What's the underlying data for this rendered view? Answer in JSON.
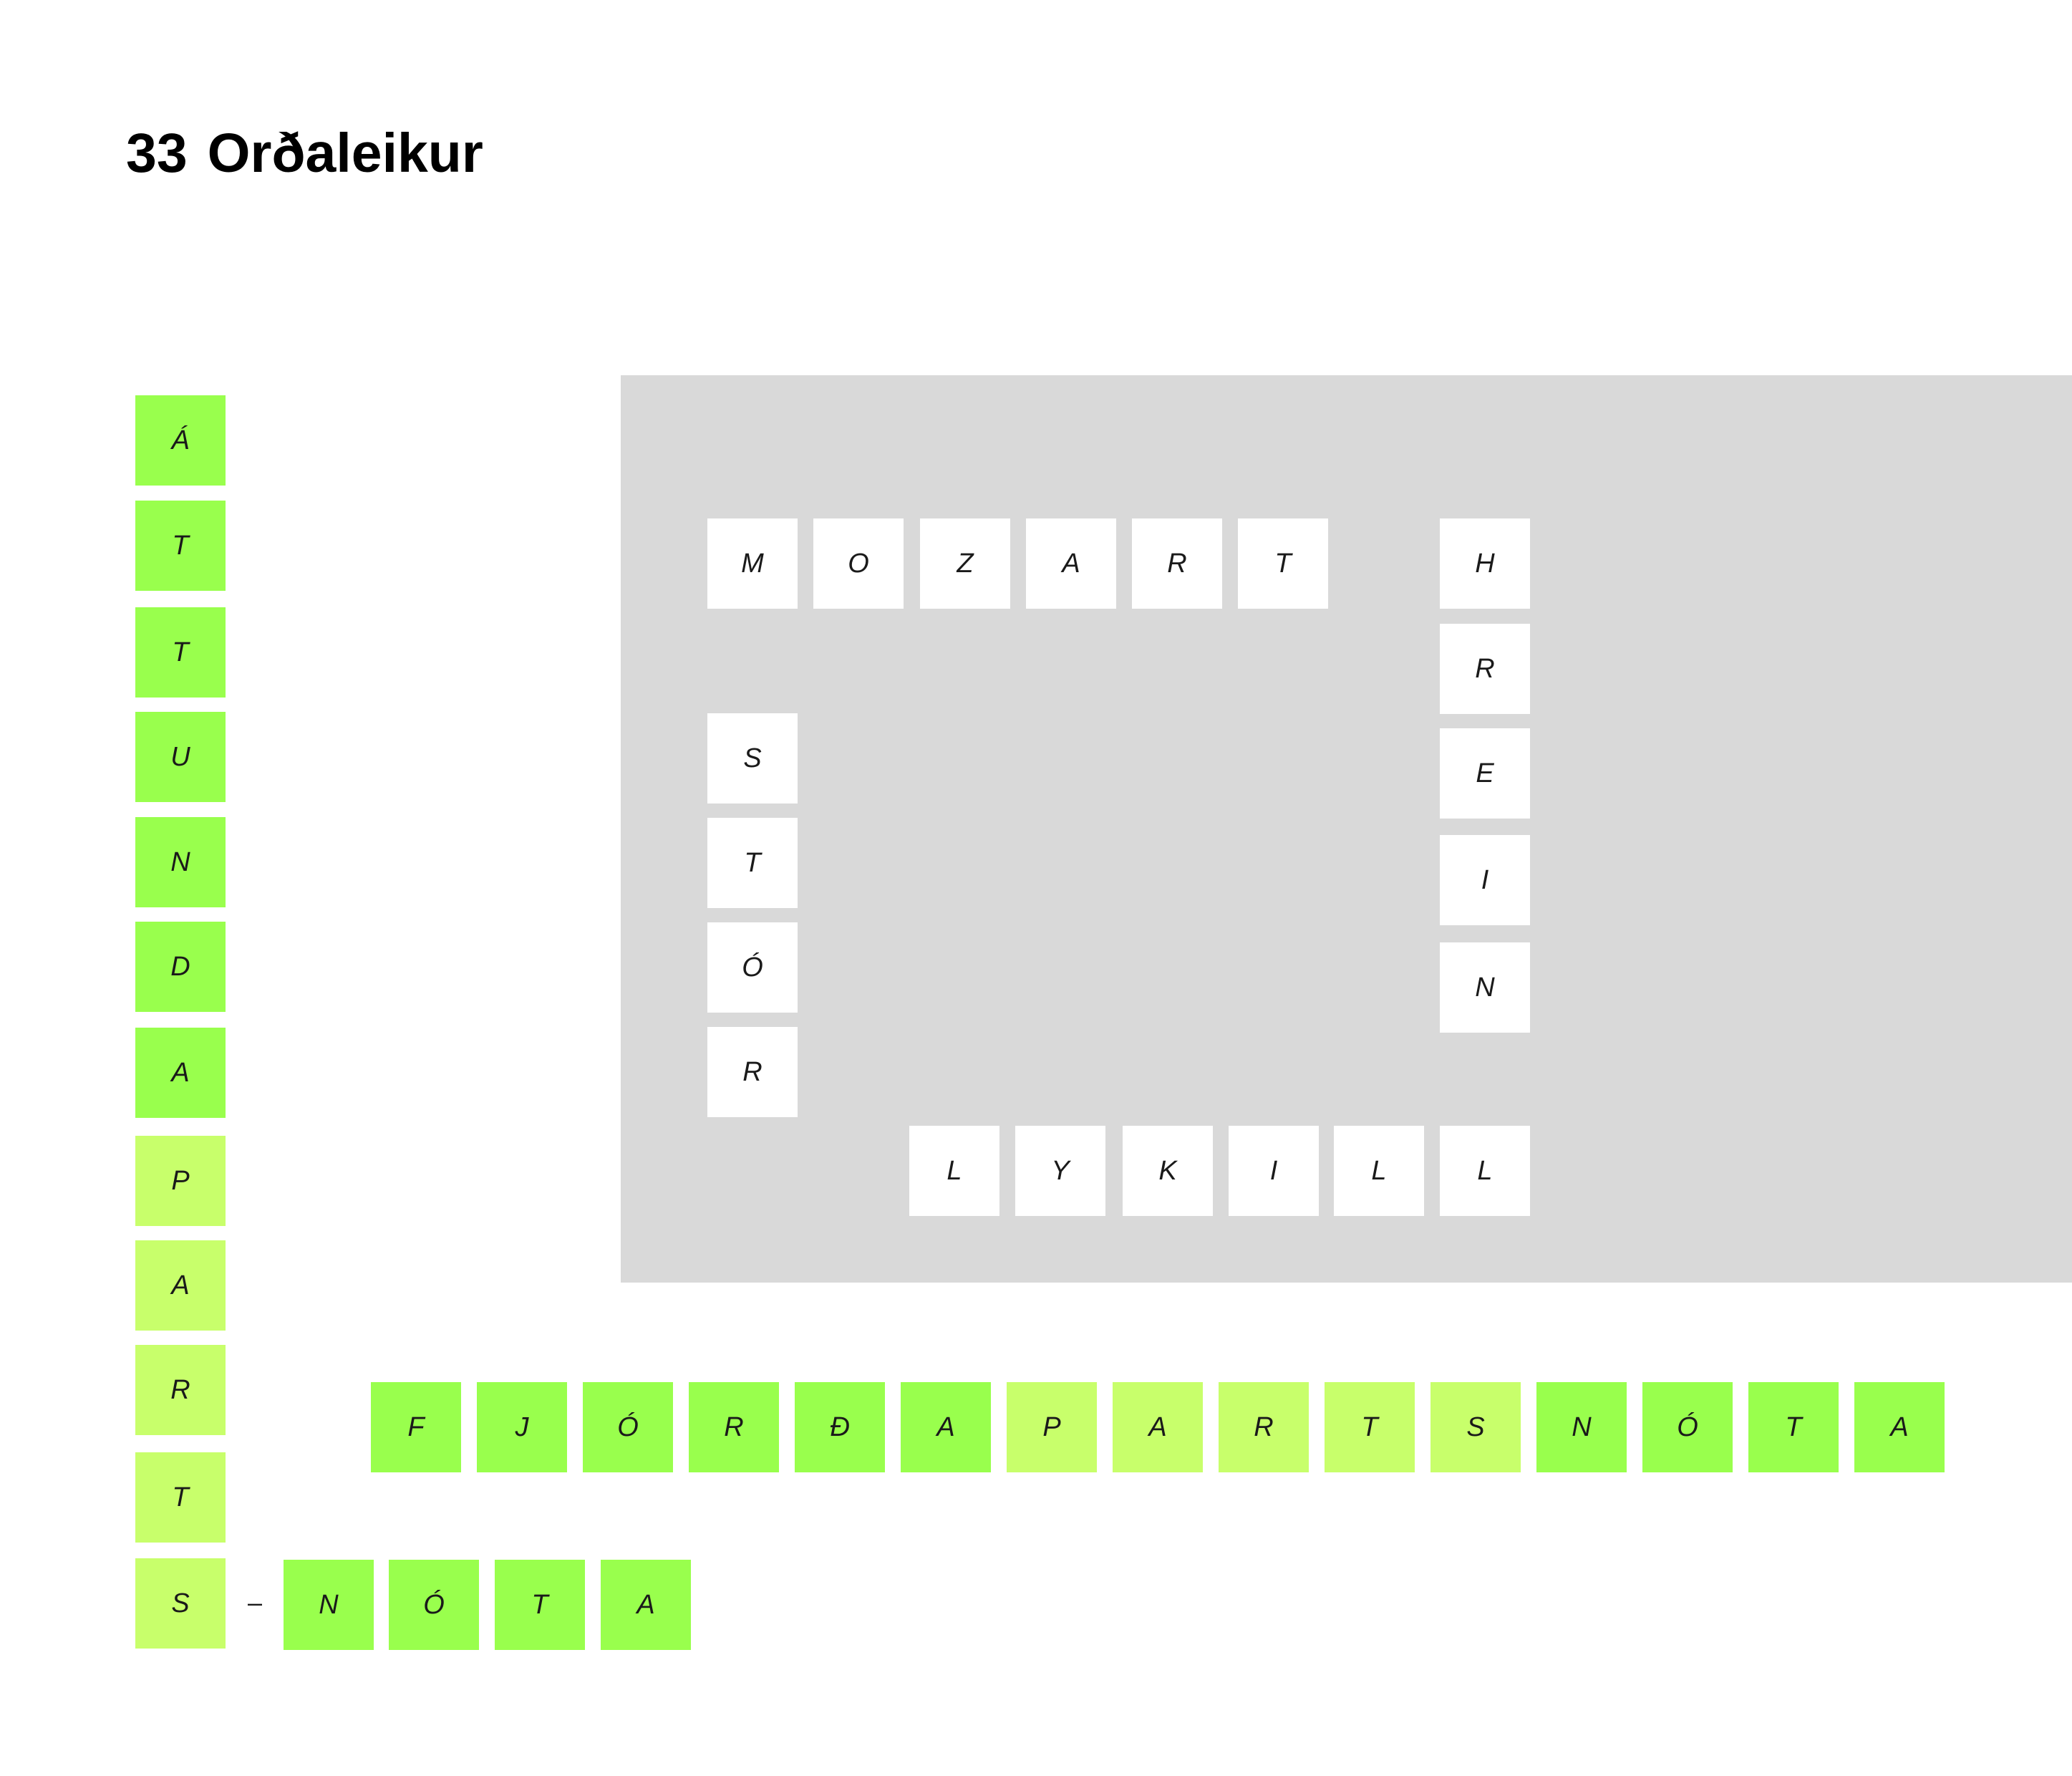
{
  "title": {
    "number": "33",
    "text": "Orðaleikur"
  },
  "colors": {
    "board": "#d9d9d9",
    "white_tile": "#ffffff",
    "green_tile": "#99ff4d",
    "light_green_tile": "#c8ff6b"
  },
  "words": {
    "mozart": [
      "M",
      "O",
      "Z",
      "A",
      "R",
      "T"
    ],
    "hrein": [
      "H",
      "R",
      "E",
      "I",
      "N"
    ],
    "stor": [
      "S",
      "T",
      "Ó",
      "R"
    ],
    "lykill": [
      "L",
      "Y",
      "K",
      "I",
      "L",
      "L"
    ],
    "attundapart_vertical": [
      "Á",
      "T",
      "T",
      "U",
      "N",
      "D",
      "A",
      "P",
      "A",
      "R",
      "T",
      "S"
    ],
    "fjordapartsnota": [
      "F",
      "J",
      "Ó",
      "R",
      "Ð",
      "A",
      "P",
      "A",
      "R",
      "T",
      "S",
      "N",
      "Ó",
      "T",
      "A"
    ],
    "nota": [
      "N",
      "Ó",
      "T",
      "A"
    ]
  },
  "separator": "–"
}
